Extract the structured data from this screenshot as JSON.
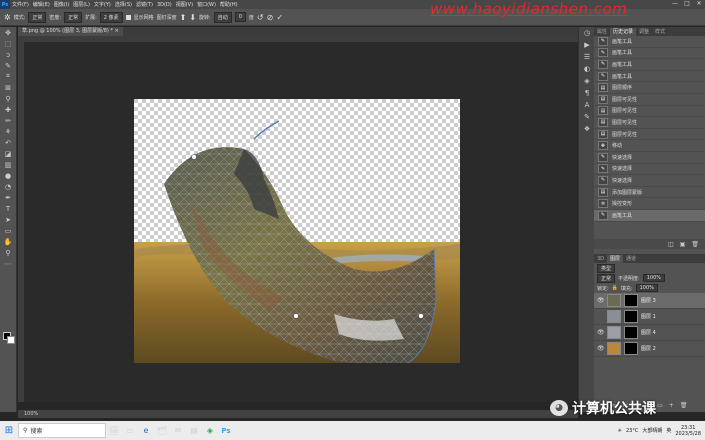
{
  "menubar": {
    "app_icon": "Ps",
    "items": [
      "文件(F)",
      "编辑(E)",
      "图像(I)",
      "图层(L)",
      "文字(Y)",
      "选择(S)",
      "滤镜(T)",
      "3D(D)",
      "视图(V)",
      "窗口(W)",
      "帮助(H)"
    ],
    "window_controls": [
      "—",
      "□",
      "✕"
    ]
  },
  "watermark": "www.haoyidianshen.com",
  "options_bar": {
    "mode_label": "模式:",
    "mode_value": "正常",
    "density_label": "密度:",
    "density_value": "正常",
    "expand_label": "扩展:",
    "expand_value": "2 像素",
    "show_mesh_label": "显示网格",
    "pin_depth_label": "图钉深度",
    "rotate_label": "旋转:",
    "rotate_value": "自动",
    "rotate_deg": "0",
    "deg_unit": "度"
  },
  "document_tab": {
    "title": "草.png @ 100% (图层 3, 图层蒙版/8) *",
    "close": "×"
  },
  "tools": [
    "move",
    "marquee",
    "lasso",
    "quick-select",
    "crop",
    "frame",
    "eyedropper",
    "healing",
    "brush",
    "clone-stamp",
    "history-brush",
    "eraser",
    "gradient",
    "blur",
    "dodge",
    "pen",
    "type",
    "path-select",
    "rectangle",
    "hand",
    "zoom",
    "more"
  ],
  "status_bar": {
    "text": "100%"
  },
  "history_panel": {
    "tabs": [
      {
        "label": "属性",
        "active": false
      },
      {
        "label": "历史记录",
        "active": true
      },
      {
        "label": "调整",
        "active": false
      },
      {
        "label": "样式",
        "active": false
      }
    ],
    "items": [
      {
        "label": "画笔工具",
        "icon": "brush-icon"
      },
      {
        "label": "画笔工具",
        "icon": "brush-icon"
      },
      {
        "label": "画笔工具",
        "icon": "brush-icon"
      },
      {
        "label": "画笔工具",
        "icon": "brush-icon"
      },
      {
        "label": "图层顺序",
        "icon": "layer-order-icon"
      },
      {
        "label": "图层可见性",
        "icon": "visibility-icon"
      },
      {
        "label": "图层可见性",
        "icon": "visibility-icon"
      },
      {
        "label": "图层可见性",
        "icon": "visibility-icon"
      },
      {
        "label": "图层可见性",
        "icon": "visibility-icon"
      },
      {
        "label": "移动",
        "icon": "move-icon"
      },
      {
        "label": "快速选择",
        "icon": "quick-select-icon"
      },
      {
        "label": "快速选择",
        "icon": "quick-select-icon"
      },
      {
        "label": "快速选择",
        "icon": "quick-select-icon"
      },
      {
        "label": "添加图层蒙版",
        "icon": "layer-mask-icon"
      },
      {
        "label": "操控变形",
        "icon": "puppet-warp-icon"
      },
      {
        "label": "画笔工具",
        "icon": "brush-icon",
        "selected": true
      }
    ],
    "footer_icons": [
      "◫",
      "▣",
      "🗑"
    ]
  },
  "layers_panel": {
    "tabs": [
      {
        "label": "3D",
        "active": false
      },
      {
        "label": "图层",
        "active": true
      },
      {
        "label": "通道",
        "active": false
      }
    ],
    "filter_label": "类型",
    "blend_mode": "正常",
    "opacity_label": "不透明度:",
    "opacity_value": "100%",
    "lock_label": "锁定:",
    "fill_label": "填充:",
    "fill_value": "100%",
    "layers": [
      {
        "name": "图层 3",
        "visible": true,
        "selected": true,
        "thumb_color": "#6b6a55"
      },
      {
        "name": "图层 1",
        "visible": false,
        "selected": false,
        "thumb_color": "#8a8f95"
      },
      {
        "name": "图层 4",
        "visible": true,
        "selected": false,
        "thumb_color": "#9aa0a6"
      },
      {
        "name": "图层 2",
        "visible": true,
        "selected": false,
        "thumb_color": "#b8893a"
      }
    ],
    "footer_icons": [
      "∞",
      "fx",
      "◨",
      "◐",
      "▭",
      "+",
      "🗑"
    ]
  },
  "taskbar": {
    "start_icon": "⊞",
    "search_placeholder": "搜索",
    "apps": [
      "🖼",
      "▭",
      "e",
      "🗂",
      "✉",
      "▤",
      "◈",
      "Ps"
    ],
    "weather_temp": "23°C",
    "weather_text": "大部晴朗",
    "lang": "英",
    "time": "23:31",
    "date": "2023/5/28"
  },
  "wechat_watermark": "计算机公共课",
  "colors": {
    "menubar": "#474747",
    "panel": "#535353",
    "workspace": "#2a2a2a",
    "watermark_red": "#e8262b",
    "ps_blue": "#31a8ff"
  }
}
